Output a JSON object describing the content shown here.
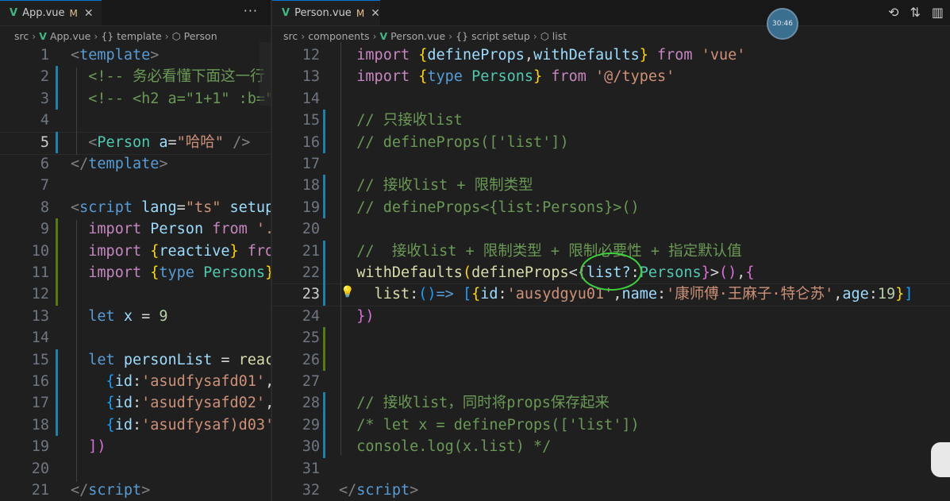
{
  "left": {
    "tab": {
      "name": "App.vue",
      "modified": "M"
    },
    "breadcrumb": {
      "seg1": "src",
      "seg2": "App.vue",
      "seg3": "template",
      "seg4": "Person"
    },
    "lines": [
      {
        "n": "1",
        "t": [
          [
            "c-punc",
            "<"
          ],
          [
            "c-tag",
            "template"
          ],
          [
            "c-punc",
            ">"
          ]
        ]
      },
      {
        "n": "2",
        "t": [
          [
            "c-com",
            "  <!-- 务必看懂下面这一行"
          ]
        ]
      },
      {
        "n": "3",
        "t": [
          [
            "c-com",
            "  <!-- <h2 a=\"1+1\" :b=\""
          ]
        ]
      },
      {
        "n": "4",
        "t": [
          [
            "c-plain",
            ""
          ]
        ]
      },
      {
        "n": "5",
        "t": [
          [
            "c-punc",
            "  <"
          ],
          [
            "c-type",
            "Person"
          ],
          [
            "c-plain",
            " "
          ],
          [
            "c-attr",
            "a"
          ],
          [
            "c-plain",
            "="
          ],
          [
            "c-str",
            "\"哈哈\""
          ],
          [
            "c-plain",
            " "
          ],
          [
            "c-punc",
            "/>"
          ]
        ]
      },
      {
        "n": "6",
        "t": [
          [
            "c-punc",
            "</"
          ],
          [
            "c-tag",
            "template"
          ],
          [
            "c-punc",
            ">"
          ]
        ]
      },
      {
        "n": "7",
        "t": [
          [
            "c-plain",
            ""
          ]
        ]
      },
      {
        "n": "8",
        "t": [
          [
            "c-punc",
            "<"
          ],
          [
            "c-tag",
            "script"
          ],
          [
            "c-plain",
            " "
          ],
          [
            "c-attr",
            "lang"
          ],
          [
            "c-plain",
            "="
          ],
          [
            "c-str",
            "\"ts\""
          ],
          [
            "c-plain",
            " "
          ],
          [
            "c-attr",
            "setup"
          ]
        ]
      },
      {
        "n": "9",
        "t": [
          [
            "c-kw2",
            "  import"
          ],
          [
            "c-plain",
            " "
          ],
          [
            "c-var",
            "Person"
          ],
          [
            "c-plain",
            " "
          ],
          [
            "c-kw2",
            "from"
          ],
          [
            "c-plain",
            " "
          ],
          [
            "c-str",
            "'."
          ]
        ]
      },
      {
        "n": "10",
        "t": [
          [
            "c-kw2",
            "  import"
          ],
          [
            "c-plain",
            " "
          ],
          [
            "c-br",
            "{"
          ],
          [
            "c-var",
            "reactive"
          ],
          [
            "c-br",
            "}"
          ],
          [
            "c-plain",
            " "
          ],
          [
            "c-kw2",
            "fro"
          ]
        ]
      },
      {
        "n": "11",
        "t": [
          [
            "c-kw2",
            "  import"
          ],
          [
            "c-plain",
            " "
          ],
          [
            "c-br",
            "{"
          ],
          [
            "c-kw",
            "type"
          ],
          [
            "c-plain",
            " "
          ],
          [
            "c-type",
            "Persons"
          ],
          [
            "c-br",
            "}"
          ]
        ]
      },
      {
        "n": "12",
        "t": [
          [
            "c-plain",
            ""
          ]
        ]
      },
      {
        "n": "13",
        "t": [
          [
            "c-kw",
            "  let"
          ],
          [
            "c-plain",
            " "
          ],
          [
            "c-var",
            "x"
          ],
          [
            "c-plain",
            " = "
          ],
          [
            "c-num",
            "9"
          ]
        ]
      },
      {
        "n": "14",
        "t": [
          [
            "c-plain",
            ""
          ]
        ]
      },
      {
        "n": "15",
        "t": [
          [
            "c-kw",
            "  let"
          ],
          [
            "c-plain",
            " "
          ],
          [
            "c-var",
            "personList"
          ],
          [
            "c-plain",
            " = "
          ],
          [
            "c-fn",
            "reac"
          ]
        ]
      },
      {
        "n": "16",
        "t": [
          [
            "c-br3",
            "    {"
          ],
          [
            "c-var",
            "id"
          ],
          [
            "c-plain",
            ":"
          ],
          [
            "c-str",
            "'asudfysafd01'"
          ],
          [
            "c-plain",
            ","
          ]
        ]
      },
      {
        "n": "17",
        "t": [
          [
            "c-br3",
            "    {"
          ],
          [
            "c-var",
            "id"
          ],
          [
            "c-plain",
            ":"
          ],
          [
            "c-str",
            "'asudfysafd02'"
          ],
          [
            "c-plain",
            ","
          ]
        ]
      },
      {
        "n": "18",
        "t": [
          [
            "c-br3",
            "    {"
          ],
          [
            "c-var",
            "id"
          ],
          [
            "c-plain",
            ":"
          ],
          [
            "c-str",
            "'asudfysaf)d03'"
          ]
        ]
      },
      {
        "n": "19",
        "t": [
          [
            "c-br2",
            "  ])"
          ]
        ]
      },
      {
        "n": "20",
        "t": [
          [
            "c-plain",
            ""
          ]
        ]
      },
      {
        "n": "21",
        "t": [
          [
            "c-punc",
            "</"
          ],
          [
            "c-tag",
            "script"
          ],
          [
            "c-punc",
            ">"
          ]
        ]
      }
    ]
  },
  "right": {
    "tab": {
      "name": "Person.vue",
      "modified": "M"
    },
    "breadcrumb": {
      "seg1": "src",
      "seg2": "components",
      "seg3": "Person.vue",
      "seg4": "script setup",
      "seg5": "list"
    },
    "avatar_text": "30:46",
    "lines": [
      {
        "n": "12",
        "t": [
          [
            "c-kw2",
            "  import"
          ],
          [
            "c-plain",
            " "
          ],
          [
            "c-br",
            "{"
          ],
          [
            "c-var",
            "defineProps"
          ],
          [
            "c-plain",
            ","
          ],
          [
            "c-var",
            "withDefaults"
          ],
          [
            "c-br",
            "}"
          ],
          [
            "c-plain",
            " "
          ],
          [
            "c-kw2",
            "from"
          ],
          [
            "c-plain",
            " "
          ],
          [
            "c-str",
            "'vue'"
          ]
        ]
      },
      {
        "n": "13",
        "t": [
          [
            "c-kw2",
            "  import"
          ],
          [
            "c-plain",
            " "
          ],
          [
            "c-br",
            "{"
          ],
          [
            "c-kw",
            "type"
          ],
          [
            "c-plain",
            " "
          ],
          [
            "c-type",
            "Persons"
          ],
          [
            "c-br",
            "}"
          ],
          [
            "c-plain",
            " "
          ],
          [
            "c-kw2",
            "from"
          ],
          [
            "c-plain",
            " "
          ],
          [
            "c-str",
            "'@/types'"
          ]
        ]
      },
      {
        "n": "14",
        "t": [
          [
            "c-plain",
            ""
          ]
        ]
      },
      {
        "n": "15",
        "t": [
          [
            "c-com",
            "  // 只接收list"
          ]
        ]
      },
      {
        "n": "16",
        "t": [
          [
            "c-com",
            "  // defineProps(['list'])"
          ]
        ]
      },
      {
        "n": "17",
        "t": [
          [
            "c-plain",
            ""
          ]
        ]
      },
      {
        "n": "18",
        "t": [
          [
            "c-com",
            "  // 接收list + 限制类型"
          ]
        ]
      },
      {
        "n": "19",
        "t": [
          [
            "c-com",
            "  // defineProps<{list:Persons}>()"
          ]
        ]
      },
      {
        "n": "20",
        "t": [
          [
            "c-plain",
            ""
          ]
        ]
      },
      {
        "n": "21",
        "t": [
          [
            "c-com",
            "  //  接收list + 限制类型 + 限制必要性 + 指定默认值"
          ]
        ]
      },
      {
        "n": "22",
        "t": [
          [
            "c-fn",
            "  withDefaults"
          ],
          [
            "c-br",
            "("
          ],
          [
            "c-fn",
            "defineProps"
          ],
          [
            "c-plain",
            "<"
          ],
          [
            "c-br2",
            "{"
          ],
          [
            "c-var",
            "list?"
          ],
          [
            "c-plain",
            ":"
          ],
          [
            "c-type",
            "Persons"
          ],
          [
            "c-br2",
            "}"
          ],
          [
            "c-plain",
            ">"
          ],
          [
            "c-br2",
            "()"
          ],
          [
            "c-plain",
            ","
          ],
          [
            "c-br2",
            "{"
          ]
        ]
      },
      {
        "n": "23",
        "t": [
          [
            "c-fn",
            "    list"
          ],
          [
            "c-plain",
            ":"
          ],
          [
            "c-br3",
            "()"
          ],
          [
            "c-kw",
            "=>"
          ],
          [
            "c-plain",
            " "
          ],
          [
            "c-br3",
            "["
          ],
          [
            "c-br",
            "{"
          ],
          [
            "c-var",
            "id"
          ],
          [
            "c-plain",
            ":"
          ],
          [
            "c-str",
            "'ausydgyu01'"
          ],
          [
            "c-plain",
            ","
          ],
          [
            "c-var",
            "name"
          ],
          [
            "c-plain",
            ":"
          ],
          [
            "c-str",
            "'康师傅·王麻子·特仑苏'"
          ],
          [
            "c-plain",
            ","
          ],
          [
            "c-var",
            "age"
          ],
          [
            "c-plain",
            ":"
          ],
          [
            "c-num",
            "19"
          ],
          [
            "c-br",
            "}"
          ],
          [
            "c-br3",
            "]"
          ]
        ]
      },
      {
        "n": "24",
        "t": [
          [
            "c-br2",
            "  })"
          ]
        ]
      },
      {
        "n": "25",
        "t": [
          [
            "c-plain",
            ""
          ]
        ]
      },
      {
        "n": "26",
        "t": [
          [
            "c-plain",
            ""
          ]
        ]
      },
      {
        "n": "27",
        "t": [
          [
            "c-plain",
            ""
          ]
        ]
      },
      {
        "n": "28",
        "t": [
          [
            "c-com",
            "  // 接收list，同时将props保存起来"
          ]
        ]
      },
      {
        "n": "29",
        "t": [
          [
            "c-com",
            "  /* let x = defineProps(['list'])"
          ]
        ]
      },
      {
        "n": "30",
        "t": [
          [
            "c-com",
            "  console.log(x.list) */"
          ]
        ]
      },
      {
        "n": "31",
        "t": [
          [
            "c-plain",
            ""
          ]
        ]
      },
      {
        "n": "32",
        "t": [
          [
            "c-punc",
            "</"
          ],
          [
            "c-tag",
            "script"
          ],
          [
            "c-punc",
            ">"
          ]
        ]
      }
    ]
  }
}
